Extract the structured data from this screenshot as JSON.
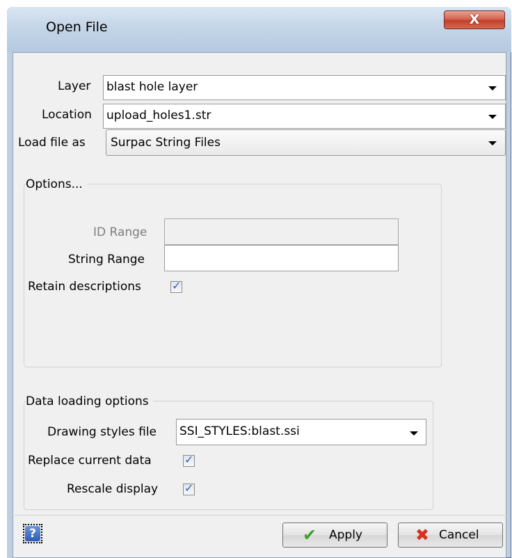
{
  "window": {
    "title": "Open File",
    "close_glyph": "X"
  },
  "fields": {
    "layer": {
      "label": "Layer",
      "value": "blast hole layer"
    },
    "location": {
      "label": "Location",
      "value": "upload_holes1.str"
    },
    "load_as": {
      "label": "Load file as",
      "value": "Surpac String Files"
    }
  },
  "options": {
    "title": "Options...",
    "id_range": {
      "label": "ID Range",
      "value": ""
    },
    "string_range": {
      "label": "String Range",
      "value": ""
    },
    "retain": {
      "label": "Retain descriptions",
      "checked": true
    }
  },
  "data_loading": {
    "title": "Data loading options",
    "styles": {
      "label": "Drawing styles file",
      "value": "SSI_STYLES:blast.ssi"
    },
    "replace": {
      "label": "Replace current data",
      "checked": true
    },
    "rescale": {
      "label": "Rescale display",
      "checked": true
    }
  },
  "buttons": {
    "help_glyph": "?",
    "apply": {
      "label": "Apply",
      "icon": "checkmark-icon",
      "color": "#3fa02c"
    },
    "cancel": {
      "label": "Cancel",
      "icon": "x-icon",
      "color": "#d8301e"
    }
  },
  "colors": {
    "check": "#3a5fa8"
  }
}
